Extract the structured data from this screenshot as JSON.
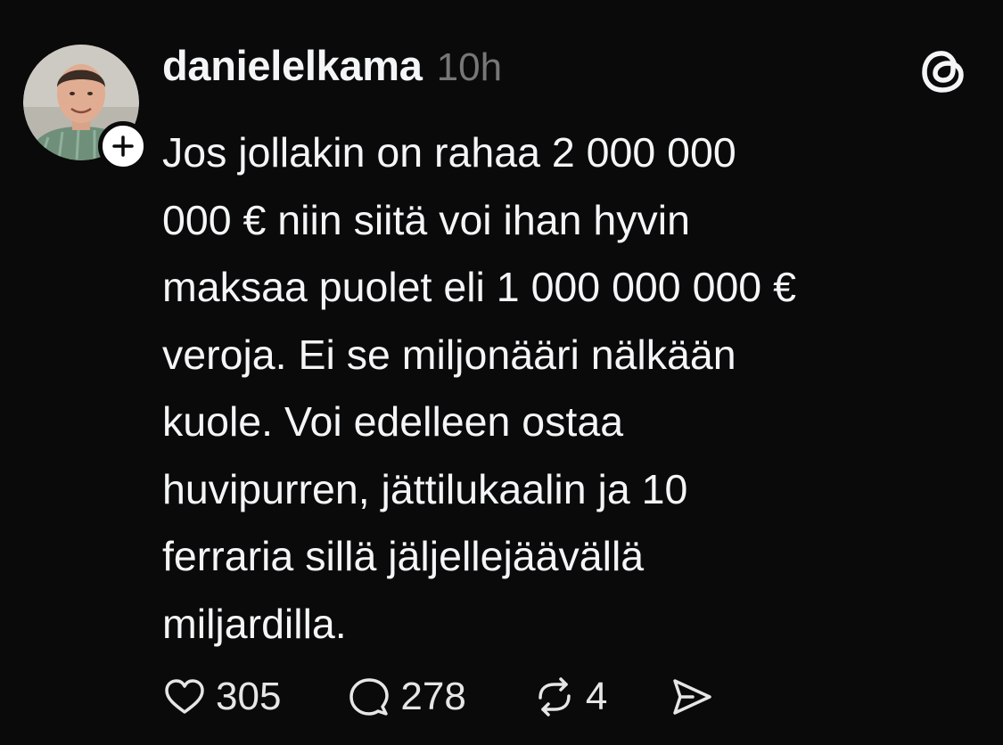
{
  "post": {
    "username": "danielelkama",
    "timestamp": "10h",
    "text_lines": [
      "Jos jollakin on rahaa 2 000 000",
      "000 € niin siitä voi ihan hyvin",
      "maksaa puolet eli 1 000 000 000 €",
      "veroja. Ei se miljonääri nälkään",
      "kuole. Voi edelleen ostaa",
      "huvipurren, jättilukaalin ja 10",
      "ferraria sillä jäljellejäävällä",
      "miljardilla."
    ],
    "actions": {
      "likes": "305",
      "replies": "278",
      "reposts": "4"
    }
  },
  "icons": {
    "avatar": "profile-photo",
    "follow": "plus-icon",
    "logo": "threads-logo-icon",
    "like": "heart-icon",
    "reply": "comment-bubble-icon",
    "repost": "repost-icon",
    "share": "send-icon"
  },
  "colors": {
    "background": "#0a0a0a",
    "text": "#f3f5f7",
    "muted": "#777777"
  }
}
